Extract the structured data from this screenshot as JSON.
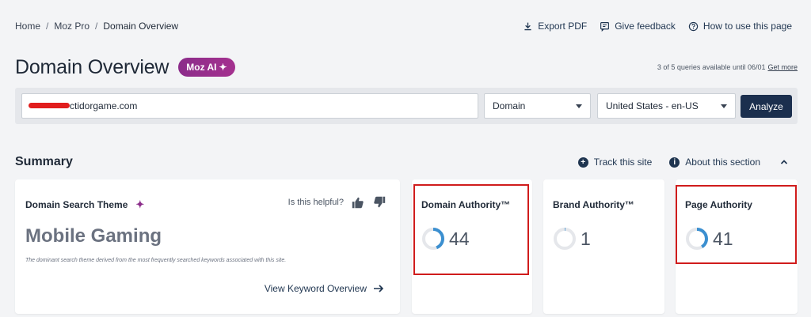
{
  "breadcrumb": {
    "home": "Home",
    "section": "Moz Pro",
    "current": "Domain Overview"
  },
  "header_actions": {
    "export": "Export PDF",
    "feedback": "Give feedback",
    "howto": "How to use this page"
  },
  "page": {
    "title": "Domain Overview",
    "ai_badge": "Moz AI"
  },
  "quota": {
    "text": "3 of 5 queries available until 06/01",
    "link": "Get more"
  },
  "search": {
    "domain_value": "ctidorgame.com",
    "type_value": "Domain",
    "locale_value": "United States - en-US",
    "analyze_label": "Analyze"
  },
  "summary": {
    "title": "Summary",
    "track": "Track this site",
    "about": "About this section"
  },
  "theme_card": {
    "title": "Domain Search Theme",
    "helpful": "Is this helpful?",
    "value": "Mobile Gaming",
    "description": "The dominant search theme derived from the most frequently searched keywords associated with this site.",
    "link": "View Keyword Overview"
  },
  "metrics": [
    {
      "title": "Domain Authority™",
      "value": "44",
      "fraction": 0.44
    },
    {
      "title": "Brand Authority™",
      "value": "1",
      "fraction": 0.01
    },
    {
      "title": "Page Authority",
      "value": "41",
      "fraction": 0.41
    }
  ],
  "colors": {
    "accent": "#1b2f4e",
    "ai_purple": "#8b2c8a",
    "gauge": "#3b8fd0",
    "gauge_track": "#e5e7eb",
    "highlight": "#d01c1c"
  },
  "icons": [
    "download-icon",
    "feedback-icon",
    "help-icon",
    "sparkle-icon",
    "plus-circle-icon",
    "info-icon",
    "chevron-up-icon",
    "thumbs-up-icon",
    "thumbs-down-icon",
    "arrow-right-icon"
  ]
}
